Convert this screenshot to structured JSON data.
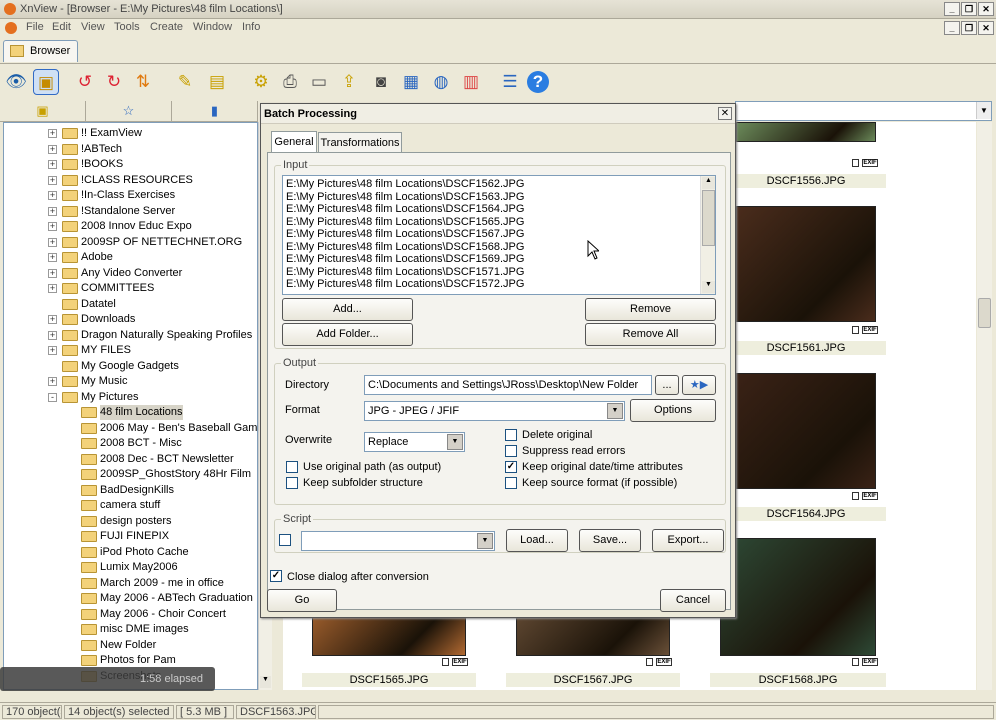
{
  "window": {
    "title": "XnView - [Browser - E:\\My Pictures\\48 film Locations\\]"
  },
  "menu": [
    "File",
    "Edit",
    "View",
    "Tools",
    "Create",
    "Window",
    "Info"
  ],
  "tabs": {
    "browser": "Browser"
  },
  "tree": {
    "items": [
      {
        "label": "!! ExamView",
        "expand": "+"
      },
      {
        "label": "!ABTech",
        "expand": "+"
      },
      {
        "label": "!BOOKS",
        "expand": "+"
      },
      {
        "label": "!CLASS RESOURCES",
        "expand": "+"
      },
      {
        "label": "!In-Class Exercises",
        "expand": "+"
      },
      {
        "label": "!Standalone Server",
        "expand": "+"
      },
      {
        "label": "2008 Innov Educ Expo",
        "expand": "+"
      },
      {
        "label": "2009SP OF NETTECHNET.ORG",
        "expand": "+"
      },
      {
        "label": "Adobe",
        "expand": "+"
      },
      {
        "label": "Any Video Converter",
        "expand": "+"
      },
      {
        "label": "COMMITTEES",
        "expand": "+"
      },
      {
        "label": "Datatel",
        "expand": ""
      },
      {
        "label": "Downloads",
        "expand": "+"
      },
      {
        "label": "Dragon Naturally Speaking Profiles",
        "expand": "+"
      },
      {
        "label": "MY FILES",
        "expand": "+"
      },
      {
        "label": "My Google Gadgets",
        "expand": ""
      },
      {
        "label": "My Music",
        "expand": "+"
      },
      {
        "label": "My Pictures",
        "expand": "-"
      }
    ],
    "sub_items": [
      "48 film Locations",
      "2006 May - Ben's Baseball Game",
      "2008 BCT - Misc",
      "2008 Dec - BCT Newsletter",
      "2009SP_GhostStory 48Hr Film",
      "BadDesignKills",
      "camera stuff",
      "design posters",
      "FUJI FINEPIX",
      "iPod Photo Cache",
      "Lumix May2006",
      "March 2009 - me in office",
      "May 2006 - ABTech Graduation",
      "May 2006 - Choir Concert",
      "misc DME images",
      "New Folder",
      "Photos for Pam",
      "Screenshots"
    ]
  },
  "dialog": {
    "title": "Batch Processing",
    "tabs": {
      "general": "General",
      "transformations": "Transformations"
    },
    "input": {
      "legend": "Input",
      "files": [
        "E:\\My Pictures\\48 film Locations\\DSCF1562.JPG",
        "E:\\My Pictures\\48 film Locations\\DSCF1563.JPG",
        "E:\\My Pictures\\48 film Locations\\DSCF1564.JPG",
        "E:\\My Pictures\\48 film Locations\\DSCF1565.JPG",
        "E:\\My Pictures\\48 film Locations\\DSCF1567.JPG",
        "E:\\My Pictures\\48 film Locations\\DSCF1568.JPG",
        "E:\\My Pictures\\48 film Locations\\DSCF1569.JPG",
        "E:\\My Pictures\\48 film Locations\\DSCF1571.JPG",
        "E:\\My Pictures\\48 film Locations\\DSCF1572.JPG"
      ],
      "add": "Add...",
      "add_folder": "Add Folder...",
      "remove": "Remove",
      "remove_all": "Remove All"
    },
    "output": {
      "legend": "Output",
      "directory_label": "Directory",
      "directory_value": "C:\\Documents and Settings\\JRoss\\Desktop\\New Folder",
      "browse": "...",
      "format_label": "Format",
      "format_value": "JPG - JPEG / JFIF",
      "options": "Options",
      "overwrite_label": "Overwrite",
      "overwrite_value": "Replace",
      "use_original_path": "Use original path (as output)",
      "keep_subfolder": "Keep subfolder structure",
      "delete_original": "Delete original",
      "suppress_errors": "Suppress read errors",
      "keep_date": "Keep original date/time attributes",
      "keep_format": "Keep source format (if possible)",
      "checks": {
        "use_original_path": false,
        "keep_subfolder": false,
        "delete_original": false,
        "suppress_errors": false,
        "keep_date": true,
        "keep_format": false
      }
    },
    "script": {
      "legend": "Script",
      "value": "",
      "load": "Load...",
      "save": "Save...",
      "export": "Export..."
    },
    "close_after": "Close dialog after conversion",
    "close_after_checked": true,
    "go": "Go",
    "cancel": "Cancel"
  },
  "thumbnails": [
    {
      "name": "DSCF1556.JPG"
    },
    {
      "name": "DSCF1561.JPG"
    },
    {
      "name": "DSCF1564.JPG"
    },
    {
      "name": "DSCF1565.JPG"
    },
    {
      "name": "DSCF1567.JPG"
    },
    {
      "name": "DSCF1568.JPG"
    }
  ],
  "exif_tag": "EXIF",
  "status": {
    "objects": "170 object(s)",
    "selected": "14 object(s) selected",
    "size": "[ 5.3 MB ]",
    "file": "DSCF1563.JPG",
    "elapsed": "1:58 elapsed"
  },
  "colors": {
    "accent": "#316ac5",
    "folder": "#f3d27a"
  }
}
